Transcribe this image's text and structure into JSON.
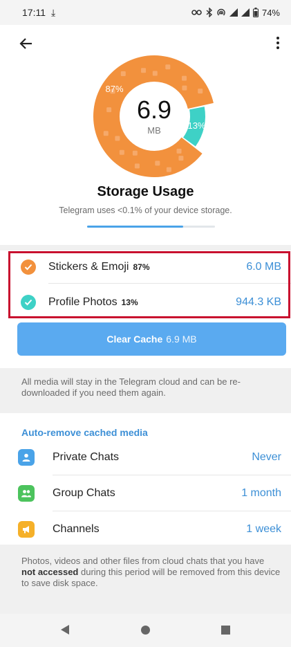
{
  "status_bar": {
    "time": "17:11",
    "download_glyph": "⤓",
    "icons": [
      "key-icon",
      "bluetooth-icon",
      "hotspot-icon",
      "signal-icon",
      "signal-icon",
      "battery-icon"
    ],
    "battery": "74%"
  },
  "header": {
    "back_icon": "arrow-left-icon",
    "more_icon": "more-vertical-icon"
  },
  "chart_data": {
    "type": "pie",
    "center_value": "6.9",
    "center_unit": "MB",
    "slices": [
      {
        "name": "Stickers & Emoji",
        "value": 87,
        "label": "87%",
        "color": "#f2913d"
      },
      {
        "name": "Profile Photos",
        "value": 13,
        "label": "13%",
        "color": "#3ed1c6"
      }
    ]
  },
  "storage": {
    "title": "Storage Usage",
    "subtitle": "Telegram uses <0.1% of your device storage.",
    "usage_fraction": 0.75
  },
  "categories": [
    {
      "name": "Stickers & Emoji",
      "percent": "87%",
      "size": "6.0 MB",
      "color": "#f2913d",
      "checked": true
    },
    {
      "name": "Profile Photos",
      "percent": "13%",
      "size": "944.3 KB",
      "color": "#3ed1c6",
      "checked": true
    }
  ],
  "clear_cache": {
    "label": "Clear Cache",
    "size": "6.9 MB"
  },
  "cloud_note": "All media will stay in the Telegram cloud and can be re-downloaded if you need them again.",
  "auto_remove": {
    "heading": "Auto-remove cached media",
    "items": [
      {
        "label": "Private Chats",
        "value": "Never",
        "icon": "person-icon",
        "color": "#4aa3e8"
      },
      {
        "label": "Group Chats",
        "value": "1 month",
        "icon": "group-icon",
        "color": "#4cc35d"
      },
      {
        "label": "Channels",
        "value": "1 week",
        "icon": "megaphone-icon",
        "color": "#f5b029"
      }
    ]
  },
  "footer_note": {
    "before": "Photos, videos and other files from cloud chats that you have ",
    "bold": "not accessed",
    "after": " during this period will be removed from this device to save disk space."
  },
  "colors": {
    "accent": "#3c8fd6",
    "button": "#5aaaf0",
    "highlight": "#c8102e"
  }
}
